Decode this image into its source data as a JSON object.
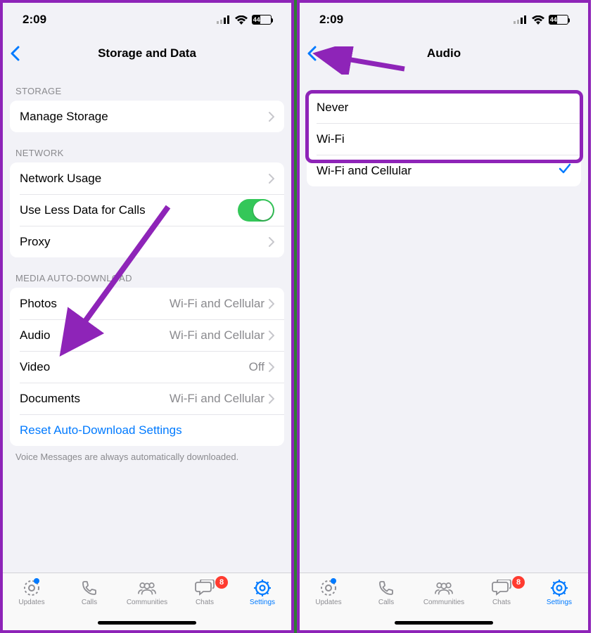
{
  "status": {
    "time": "2:09",
    "battery": "44"
  },
  "left": {
    "title": "Storage and Data",
    "sections": {
      "storage": {
        "header": "STORAGE",
        "manage": "Manage Storage"
      },
      "network": {
        "header": "NETWORK",
        "usage": "Network Usage",
        "lessdata": "Use Less Data for Calls",
        "proxy": "Proxy"
      },
      "media": {
        "header": "MEDIA AUTO-DOWNLOAD",
        "photos": {
          "label": "Photos",
          "value": "Wi-Fi and Cellular"
        },
        "audio": {
          "label": "Audio",
          "value": "Wi-Fi and Cellular"
        },
        "video": {
          "label": "Video",
          "value": "Off"
        },
        "documents": {
          "label": "Documents",
          "value": "Wi-Fi and Cellular"
        },
        "reset": "Reset Auto-Download Settings",
        "footnote": "Voice Messages are always automatically downloaded."
      }
    }
  },
  "right": {
    "title": "Audio",
    "options": {
      "never": "Never",
      "wifi": "Wi-Fi",
      "wificell": "Wi-Fi and Cellular"
    }
  },
  "tabs": {
    "updates": "Updates",
    "calls": "Calls",
    "communities": "Communities",
    "chats": "Chats",
    "chats_badge": "8",
    "settings": "Settings"
  }
}
